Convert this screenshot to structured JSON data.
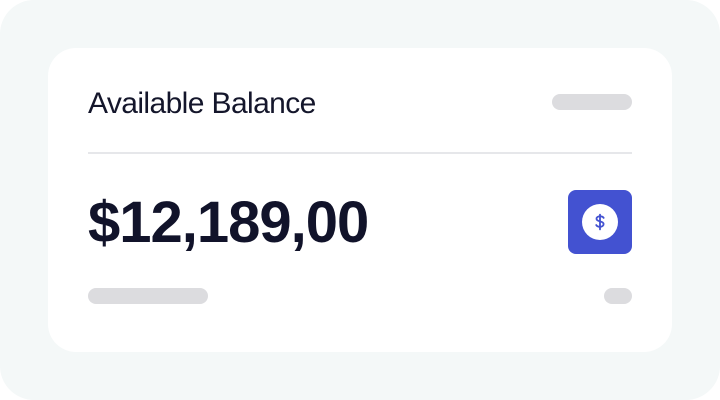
{
  "balance_card": {
    "title": "Available Balance",
    "amount": "$12,189,00",
    "icon": "dollar-icon",
    "accent_color": "#4352d1"
  }
}
